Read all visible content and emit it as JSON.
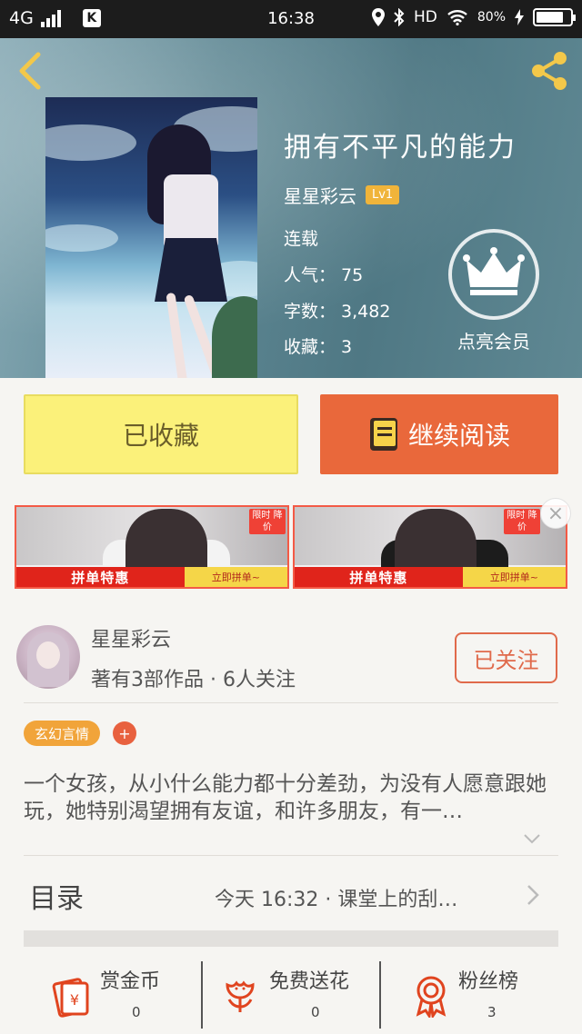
{
  "status_bar": {
    "network": "4G",
    "app_badge": "K",
    "time": "16:38",
    "hd": "HD",
    "battery": "80%",
    "battery_fill": 0.8
  },
  "book": {
    "title": "拥有不平凡的能力",
    "author": "星星彩云",
    "level": "Lv1",
    "status": "连载",
    "popularity": "人气： 75",
    "word_count": "字数： 3,482",
    "favorites": "收藏： 3",
    "vip_label": "点亮会员"
  },
  "actions": {
    "collected_label": "已收藏",
    "read_label": "继续阅读"
  },
  "ads": [
    {
      "tag": "限时 降价",
      "banner": "拼单特惠",
      "cta": "立即拼单~"
    },
    {
      "tag": "限时 降价",
      "banner": "拼单特惠",
      "cta": "立即拼单~"
    }
  ],
  "ad_close": "×",
  "author_card": {
    "name": "星星彩云",
    "stats": "著有3部作品 · 6人关注",
    "follow_label": "已关注"
  },
  "tags": {
    "genre": "玄幻言情",
    "add": "+"
  },
  "description": "一个女孩，从小什么能力都十分差劲，为没有人愿意跟她玩，她特别渴望拥有友谊，和许多朋友，有一…",
  "toc": {
    "title": "目录",
    "latest": "今天 16:32 · 课堂上的刮…"
  },
  "bottom_bar": [
    {
      "icon": "coin-envelope-icon",
      "label": "赏金币",
      "count": "0"
    },
    {
      "icon": "flower-icon",
      "label": "免费送花",
      "count": "0"
    },
    {
      "icon": "ribbon-medal-icon",
      "label": "粉丝榜",
      "count": "3"
    }
  ],
  "colors": {
    "accent_orange": "#e9683b",
    "collected_yellow": "#fbf17a",
    "tag_orange": "#f1a43a",
    "icon_red": "#e0441f"
  }
}
